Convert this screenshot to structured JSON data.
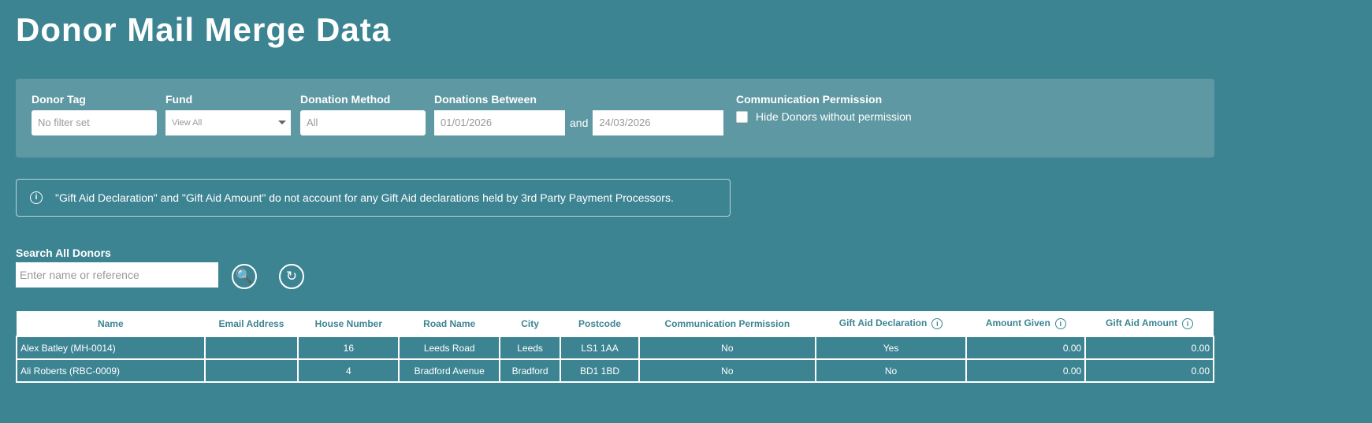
{
  "page_title": "Donor Mail Merge Data",
  "filters": {
    "donor_tag": {
      "label": "Donor Tag",
      "placeholder": "No filter set"
    },
    "fund": {
      "label": "Fund",
      "value": "View All"
    },
    "donation_method": {
      "label": "Donation Method",
      "value": "All"
    },
    "donations_between": {
      "label": "Donations Between",
      "from": "01/01/2026",
      "and": "and",
      "to": "24/03/2026"
    },
    "communication_permission": {
      "label": "Communication Permission",
      "checkbox_label": "Hide Donors without permission",
      "checked": false
    }
  },
  "notice": "\"Gift Aid Declaration\" and \"Gift Aid Amount\" do not account for any Gift Aid declarations held by 3rd Party Payment Processors.",
  "search": {
    "label": "Search All Donors",
    "placeholder": "Enter name or reference"
  },
  "table": {
    "headers": [
      "Name",
      "Email Address",
      "House Number",
      "Road Name",
      "City",
      "Postcode",
      "Communication Permission",
      "Gift Aid Declaration",
      "Amount Given",
      "Gift Aid Amount"
    ],
    "rows": [
      [
        "Alex Batley (MH-0014)",
        "",
        "16",
        "Leeds Road",
        "Leeds",
        "LS1 1AA",
        "No",
        "Yes",
        "0.00",
        "0.00"
      ],
      [
        "Ali Roberts (RBC-0009)",
        "",
        "4",
        "Bradford Avenue",
        "Bradford",
        "BD1 1BD",
        "No",
        "No",
        "0.00",
        "0.00"
      ]
    ]
  }
}
